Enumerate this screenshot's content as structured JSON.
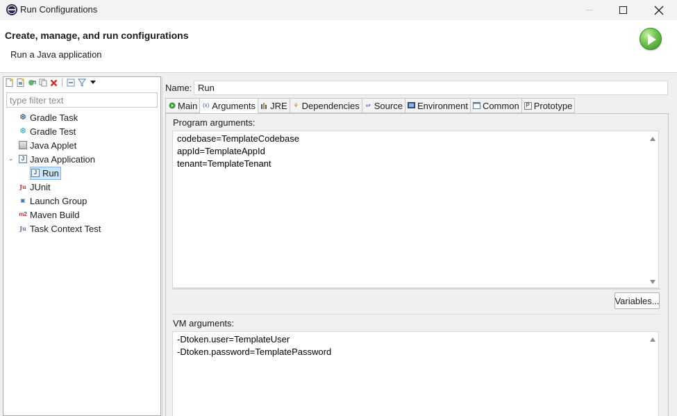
{
  "window": {
    "title": "Run Configurations"
  },
  "header": {
    "title": "Create, manage, and run configurations",
    "subtitle": "Run a Java application"
  },
  "filter": {
    "placeholder": "type filter text",
    "value": ""
  },
  "tree": {
    "items": [
      {
        "label": "Gradle Task",
        "icon": "gradle-task-icon"
      },
      {
        "label": "Gradle Test",
        "icon": "gradle-test-icon"
      },
      {
        "label": "Java Applet",
        "icon": "java-applet-icon"
      },
      {
        "label": "Java Application",
        "icon": "java-application-icon",
        "expanded": true,
        "children": [
          {
            "label": "Run",
            "icon": "java-run-config-icon",
            "selected": true
          }
        ]
      },
      {
        "label": "JUnit",
        "icon": "junit-icon"
      },
      {
        "label": "Launch Group",
        "icon": "launch-group-icon"
      },
      {
        "label": "Maven Build",
        "icon": "maven-icon"
      },
      {
        "label": "Task Context Test",
        "icon": "task-context-test-icon"
      }
    ]
  },
  "config": {
    "name_label": "Name:",
    "name_value": "Run",
    "tabs": [
      {
        "label": "Main",
        "icon": "main-tab-icon"
      },
      {
        "label": "Arguments",
        "icon": "arguments-tab-icon",
        "active": true
      },
      {
        "label": "JRE",
        "icon": "jre-tab-icon"
      },
      {
        "label": "Dependencies",
        "icon": "dependencies-tab-icon"
      },
      {
        "label": "Source",
        "icon": "source-tab-icon"
      },
      {
        "label": "Environment",
        "icon": "environment-tab-icon"
      },
      {
        "label": "Common",
        "icon": "common-tab-icon"
      },
      {
        "label": "Prototype",
        "icon": "prototype-tab-icon"
      }
    ],
    "program_args_label": "Program arguments:",
    "program_args": "codebase=TemplateCodebase\nappId=TemplateAppId\ntenant=TemplateTenant",
    "variables_label": "Variables...",
    "vm_args_label": "VM arguments:",
    "vm_args": "-Dtoken.user=TemplateUser\n-Dtoken.password=TemplatePassword"
  },
  "colors": {
    "selection": "#cce4f7",
    "run_button": "#5cb83c"
  }
}
